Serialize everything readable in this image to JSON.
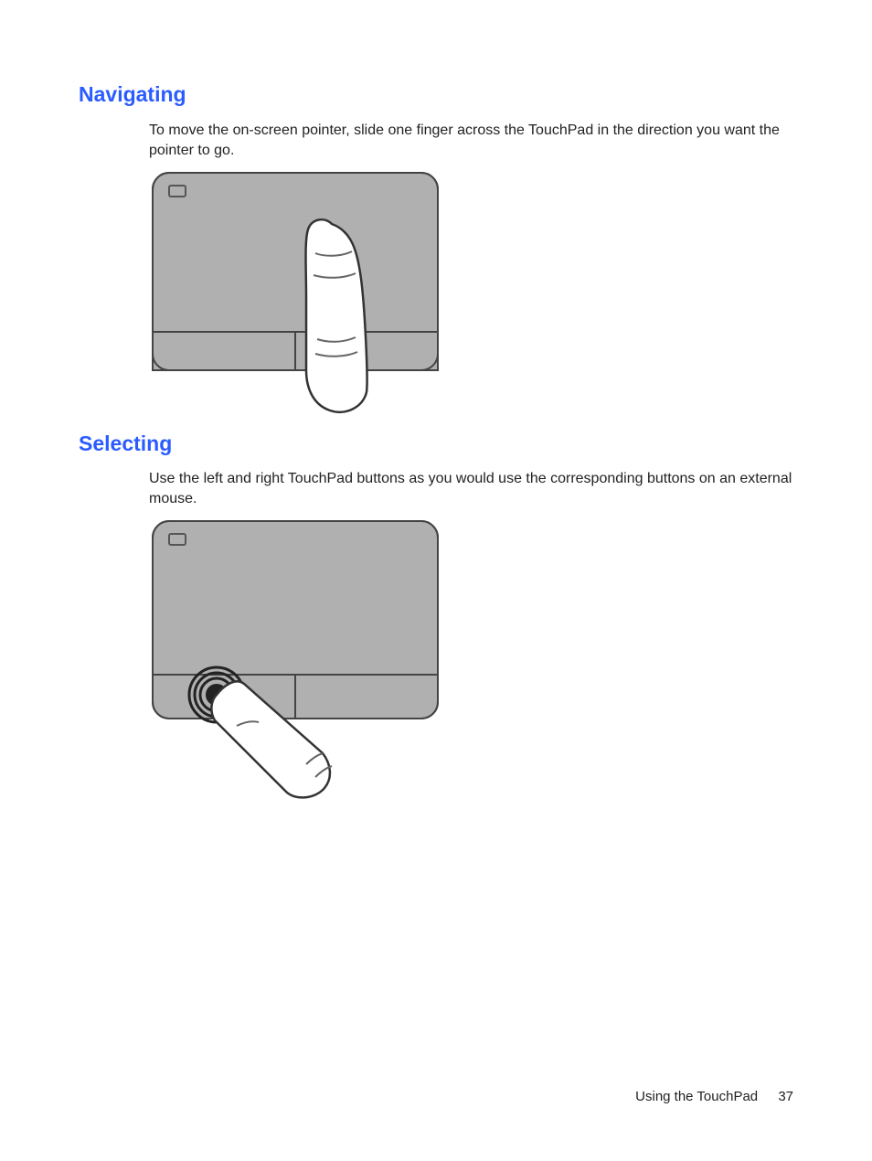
{
  "sections": {
    "navigating": {
      "heading": "Navigating",
      "body": "To move the on-screen pointer, slide one finger across the TouchPad in the direction you want the pointer to go."
    },
    "selecting": {
      "heading": "Selecting",
      "body": "Use the left and right TouchPad buttons as you would use the corresponding buttons on an external mouse."
    }
  },
  "footer": {
    "section_name": "Using the TouchPad",
    "page_number": "37"
  }
}
